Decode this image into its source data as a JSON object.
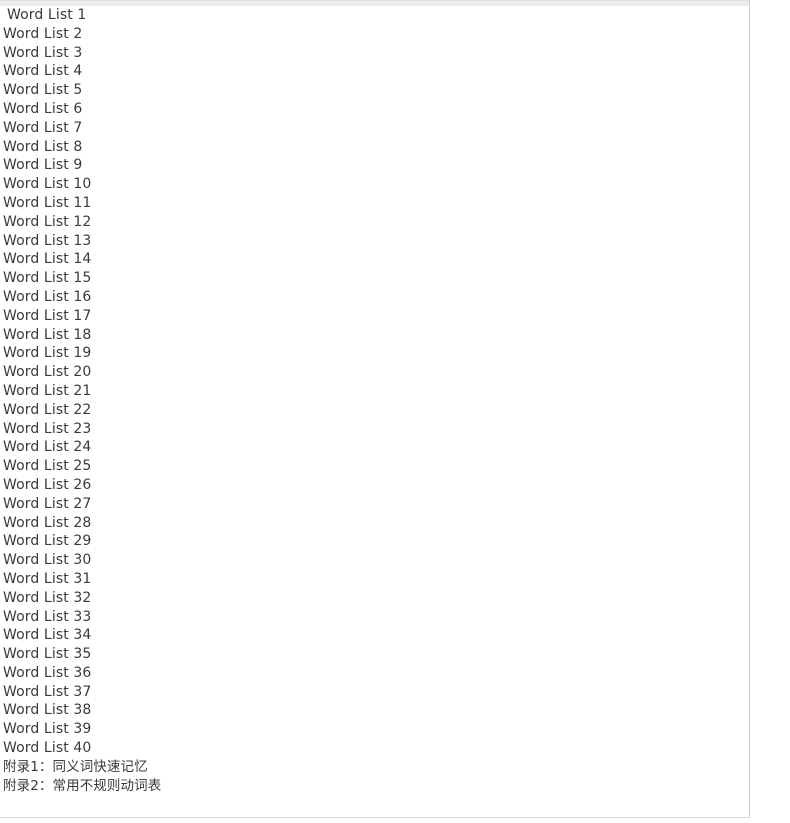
{
  "document": {
    "panel_background": "#ffffff",
    "top_band_color": "#ebebeb",
    "border_color": "#cfcfcf",
    "text_color": "#3a3a3a",
    "toc_entries": [
      "Word List 1",
      "Word List 2",
      "Word List 3",
      "Word List 4",
      "Word List 5",
      "Word List 6",
      "Word List 7",
      "Word List 8",
      "Word List 9",
      "Word List 10",
      "Word List 11",
      "Word List 12",
      "Word List 13",
      "Word List 14",
      "Word List 15",
      "Word List 16",
      "Word List 17",
      "Word List 18",
      "Word List 19",
      "Word List 20",
      "Word List 21",
      "Word List 22",
      "Word List 23",
      "Word List 24",
      "Word List 25",
      "Word List 26",
      "Word List 27",
      "Word List 28",
      "Word List 29",
      "Word List 30",
      "Word List 31",
      "Word List 32",
      "Word List 33",
      "Word List 34",
      "Word List 35",
      "Word List 36",
      "Word List 37",
      "Word List 38",
      "Word List 39",
      "Word List 40",
      "附录1：同义词快速记忆",
      "附录2：常用不规则动词表"
    ]
  }
}
